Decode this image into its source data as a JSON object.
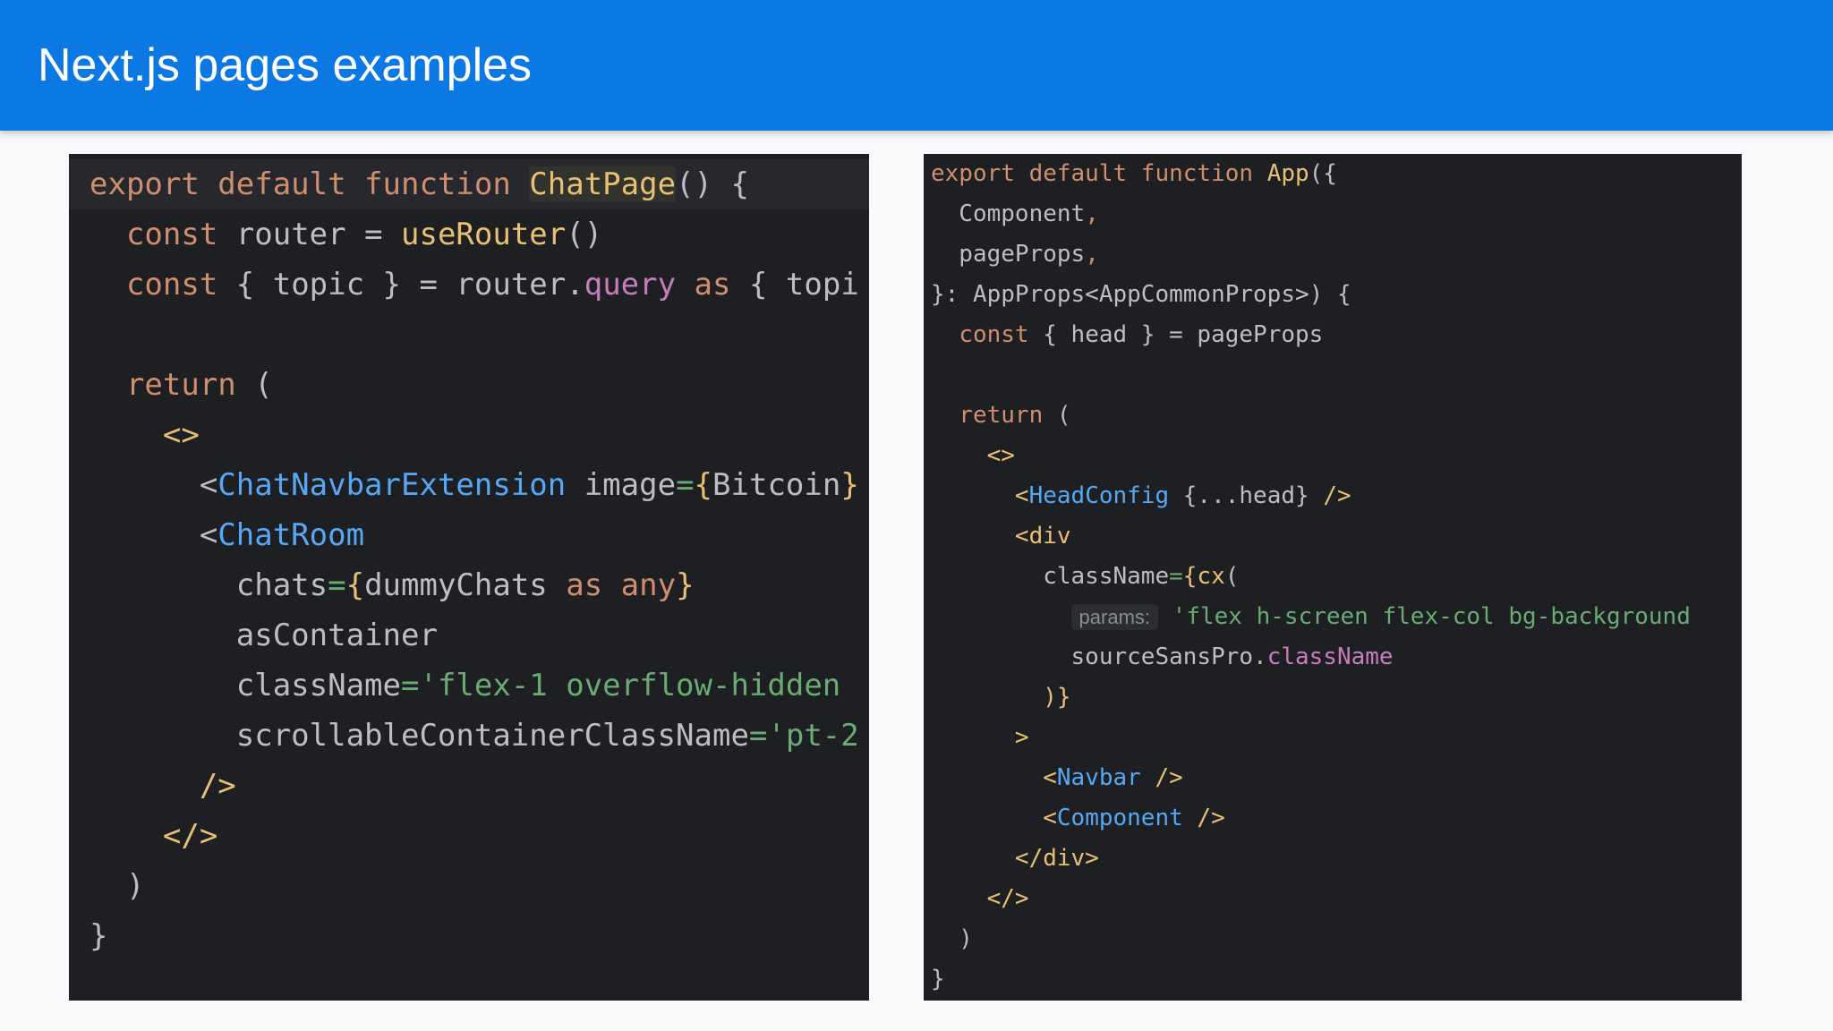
{
  "slide": {
    "title": "Next.js pages examples"
  },
  "colors": {
    "header_bg": "#0b78e3",
    "editor_bg": "#1e1f22",
    "keyword": "#cf8e6d",
    "function": "#e8c073",
    "text": "#bcbec4",
    "tag": "#56a8f5",
    "string": "#6aab73",
    "property": "#c77dbb",
    "punctuation": "#bcbec4"
  },
  "panels": [
    {
      "name": "left-code-editor",
      "lines": [
        [
          [
            "export default function ",
            "kw"
          ],
          [
            "ChatPage",
            "fnhl"
          ],
          [
            "() {",
            "txt"
          ]
        ],
        [
          [
            "  ",
            "txt"
          ],
          [
            "const ",
            "kw"
          ],
          [
            "router = ",
            "txt"
          ],
          [
            "useRouter",
            "fn"
          ],
          [
            "()",
            "txt"
          ]
        ],
        [
          [
            "  ",
            "txt"
          ],
          [
            "const ",
            "kw"
          ],
          [
            "{ topic } = router.",
            "txt"
          ],
          [
            "query",
            "prop"
          ],
          [
            " as ",
            "kw"
          ],
          [
            "{ topi",
            "txt"
          ]
        ],
        [],
        [
          [
            "  ",
            "txt"
          ],
          [
            "return ",
            "kw"
          ],
          [
            "(",
            "txt"
          ]
        ],
        [
          [
            "    ",
            "txt"
          ],
          [
            "<>",
            "fn"
          ]
        ],
        [
          [
            "      <",
            "txt"
          ],
          [
            "ChatNavbarExtension",
            "tag"
          ],
          [
            " image",
            "txt"
          ],
          [
            "=",
            "str"
          ],
          [
            "{",
            "fn"
          ],
          [
            "Bitcoin",
            "txt"
          ],
          [
            "}",
            "fn"
          ]
        ],
        [
          [
            "      <",
            "txt"
          ],
          [
            "ChatRoom",
            "tag"
          ]
        ],
        [
          [
            "        chats",
            "txt"
          ],
          [
            "=",
            "str"
          ],
          [
            "{",
            "fn"
          ],
          [
            "dummyChats",
            "txt"
          ],
          [
            " as any",
            "kw"
          ],
          [
            "}",
            "fn"
          ]
        ],
        [
          [
            "        asContainer",
            "txt"
          ]
        ],
        [
          [
            "        className",
            "txt"
          ],
          [
            "='flex-1 overflow-hidden",
            "str"
          ]
        ],
        [
          [
            "        scrollableContainerClassName",
            "txt"
          ],
          [
            "='pt-2",
            "str"
          ]
        ],
        [
          [
            "      />",
            "fn"
          ]
        ],
        [
          [
            "    </>",
            "fn"
          ]
        ],
        [
          [
            "  )",
            "txt"
          ]
        ],
        [
          [
            "}",
            "txt"
          ]
        ]
      ]
    },
    {
      "name": "right-code-editor",
      "lines": [
        [
          [
            "export default function ",
            "kw"
          ],
          [
            "App",
            "fn"
          ],
          [
            "({",
            "txt"
          ]
        ],
        [
          [
            "  Component",
            "txt"
          ],
          [
            ",",
            "kw"
          ]
        ],
        [
          [
            "  pageProps",
            "txt"
          ],
          [
            ",",
            "kw"
          ]
        ],
        [
          [
            "}: AppProps<AppCommonProps>) {",
            "txt"
          ]
        ],
        [
          [
            "  ",
            "txt"
          ],
          [
            "const ",
            "kw"
          ],
          [
            "{ head } = pageProps",
            "txt"
          ]
        ],
        [],
        [
          [
            "  ",
            "txt"
          ],
          [
            "return ",
            "kw"
          ],
          [
            "(",
            "txt"
          ]
        ],
        [
          [
            "    ",
            "txt"
          ],
          [
            "<>",
            "fn"
          ]
        ],
        [
          [
            "      <",
            "fn"
          ],
          [
            "HeadConfig",
            "tag"
          ],
          [
            " {...head} ",
            "txt"
          ],
          [
            "/>",
            "fn"
          ]
        ],
        [
          [
            "      <",
            "fn"
          ],
          [
            "div",
            "fn"
          ]
        ],
        [
          [
            "        className",
            "txt"
          ],
          [
            "=",
            "str"
          ],
          [
            "{",
            "fn"
          ],
          [
            "cx",
            "fn"
          ],
          [
            "(",
            "txt"
          ]
        ],
        [
          [
            "          ",
            "txt"
          ],
          [
            "params:",
            "hint"
          ],
          [
            " 'flex h-screen flex-col bg-background",
            "str"
          ]
        ],
        [
          [
            "          sourceSansPro.",
            "txt"
          ],
          [
            "className",
            "prop"
          ]
        ],
        [
          [
            "        )}",
            "fn"
          ]
        ],
        [
          [
            "      >",
            "fn"
          ]
        ],
        [
          [
            "        <",
            "fn"
          ],
          [
            "Navbar",
            "tag"
          ],
          [
            " />",
            "fn"
          ]
        ],
        [
          [
            "        <",
            "fn"
          ],
          [
            "Component",
            "tag"
          ],
          [
            " />",
            "fn"
          ]
        ],
        [
          [
            "      </div>",
            "fn"
          ]
        ],
        [
          [
            "    </>",
            "fn"
          ]
        ],
        [
          [
            "  )",
            "txt"
          ]
        ],
        [
          [
            "}",
            "txt"
          ]
        ]
      ]
    }
  ]
}
